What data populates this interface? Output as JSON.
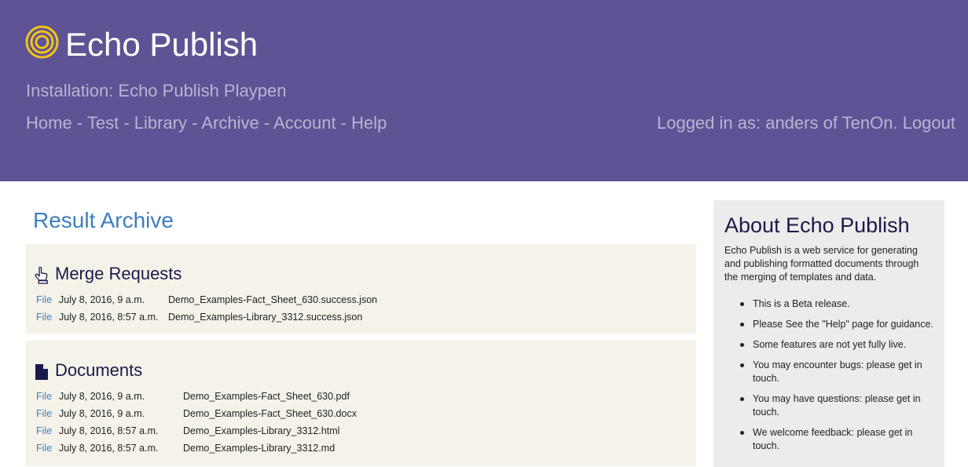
{
  "header": {
    "app_title": "Echo Publish",
    "logo_icon": "concentric-circles-logo",
    "installation": "Installation: Echo Publish Playpen",
    "nav": [
      "Home",
      "Test",
      "Library",
      "Archive",
      "Account",
      "Help"
    ],
    "nav_separator": " - ",
    "login_prefix": "Logged in as: anders of TenOn.",
    "logout_label": "Logout",
    "colors": {
      "background": "#5e5394",
      "title": "#ffffff",
      "muted": "#b9b4d2",
      "logo": "#f0c419"
    }
  },
  "main": {
    "page_title": "Result Archive",
    "merge_requests": {
      "title": "Merge Requests",
      "icon": "pointing-hand-icon",
      "rows": [
        {
          "link": "File",
          "date": "July 8, 2016, 9 a.m.",
          "name": "Demo_Examples-Fact_Sheet_630.success.json"
        },
        {
          "link": "File",
          "date": "July 8, 2016, 8:57 a.m.",
          "name": "Demo_Examples-Library_3312.success.json"
        }
      ]
    },
    "documents": {
      "title": "Documents",
      "icon": "document-icon",
      "rows": [
        {
          "link": "File",
          "date": "July 8, 2016, 9 a.m.",
          "name": "Demo_Examples-Fact_Sheet_630.pdf"
        },
        {
          "link": "File",
          "date": "July 8, 2016, 9 a.m.",
          "name": "Demo_Examples-Fact_Sheet_630.docx"
        },
        {
          "link": "File",
          "date": "July 8, 2016, 8:57 a.m.",
          "name": "Demo_Examples-Library_3312.html"
        },
        {
          "link": "File",
          "date": "July 8, 2016, 8:57 a.m.",
          "name": "Demo_Examples-Library_3312.md"
        }
      ]
    },
    "colors": {
      "link": "#3d7ec0",
      "panel": "#f5f2e9",
      "heading": "#1a1a4a"
    }
  },
  "sidebar": {
    "title": "About Echo Publish",
    "intro": "Echo Publish is a web service for generating and publishing formatted documents through the merging of templates and data.",
    "items": [
      "This is a Beta release.",
      "Please See the \"Help\" page for guidance.",
      "Some features are not yet fully live.",
      "You may encounter bugs: please get in touch.",
      "You may have questions: please get in touch.",
      "We welcome feedback: please get in touch."
    ],
    "colors": {
      "background": "#ececec"
    }
  }
}
